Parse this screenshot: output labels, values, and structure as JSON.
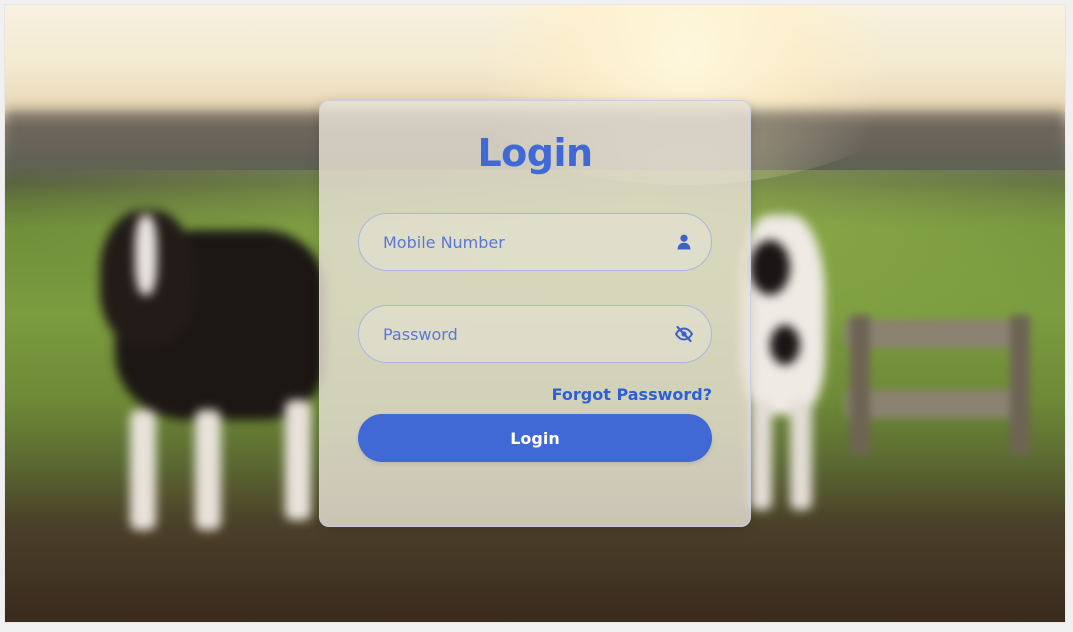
{
  "login": {
    "title": "Login",
    "mobile": {
      "placeholder": "Mobile Number",
      "value": ""
    },
    "password": {
      "placeholder": "Password",
      "value": ""
    },
    "forgot_label": "Forgot Password?",
    "submit_label": "Login"
  },
  "icons": {
    "mobile": "user-icon",
    "password": "eye-slash-icon"
  },
  "colors": {
    "accent": "#4169d6",
    "link": "#2f5fd8",
    "input_border": "#a8b6e4",
    "button_text": "#ffffff"
  }
}
